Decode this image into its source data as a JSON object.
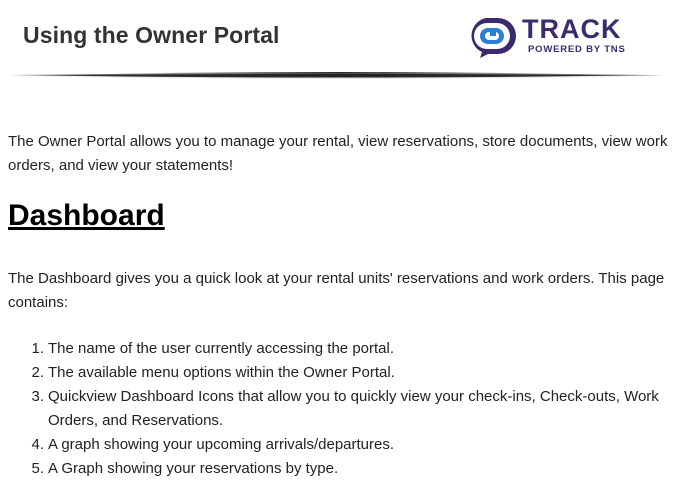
{
  "header": {
    "title": "Using the Owner Portal",
    "logo": {
      "word": "TRACK",
      "tagline": "POWERED BY TNS",
      "icon": "track-logo-icon",
      "colors": {
        "blue": "#2a7fd4",
        "purple": "#3b2a6e"
      }
    }
  },
  "intro": "The Owner Portal allows you to manage your rental, view reservations, store documents, view work orders, and view your statements!",
  "dashboard": {
    "heading": "Dashboard",
    "description": "The Dashboard gives you a quick look at your rental units' reservations and work orders. This page contains:",
    "items": [
      {
        "num": "1.",
        "text": "The name of the user currently accessing the portal."
      },
      {
        "num": "2.",
        "text": "The available menu options within the Owner Portal."
      },
      {
        "num": "3.",
        "text": "Quickview Dashboard Icons that allow you to quickly view your check-ins, Check-outs, Work Orders, and Reservations."
      },
      {
        "num": "4.",
        "text": "A graph showing your upcoming arrivals/departures."
      },
      {
        "num": "5.",
        "text": "A Graph showing your reservations by type."
      }
    ]
  }
}
